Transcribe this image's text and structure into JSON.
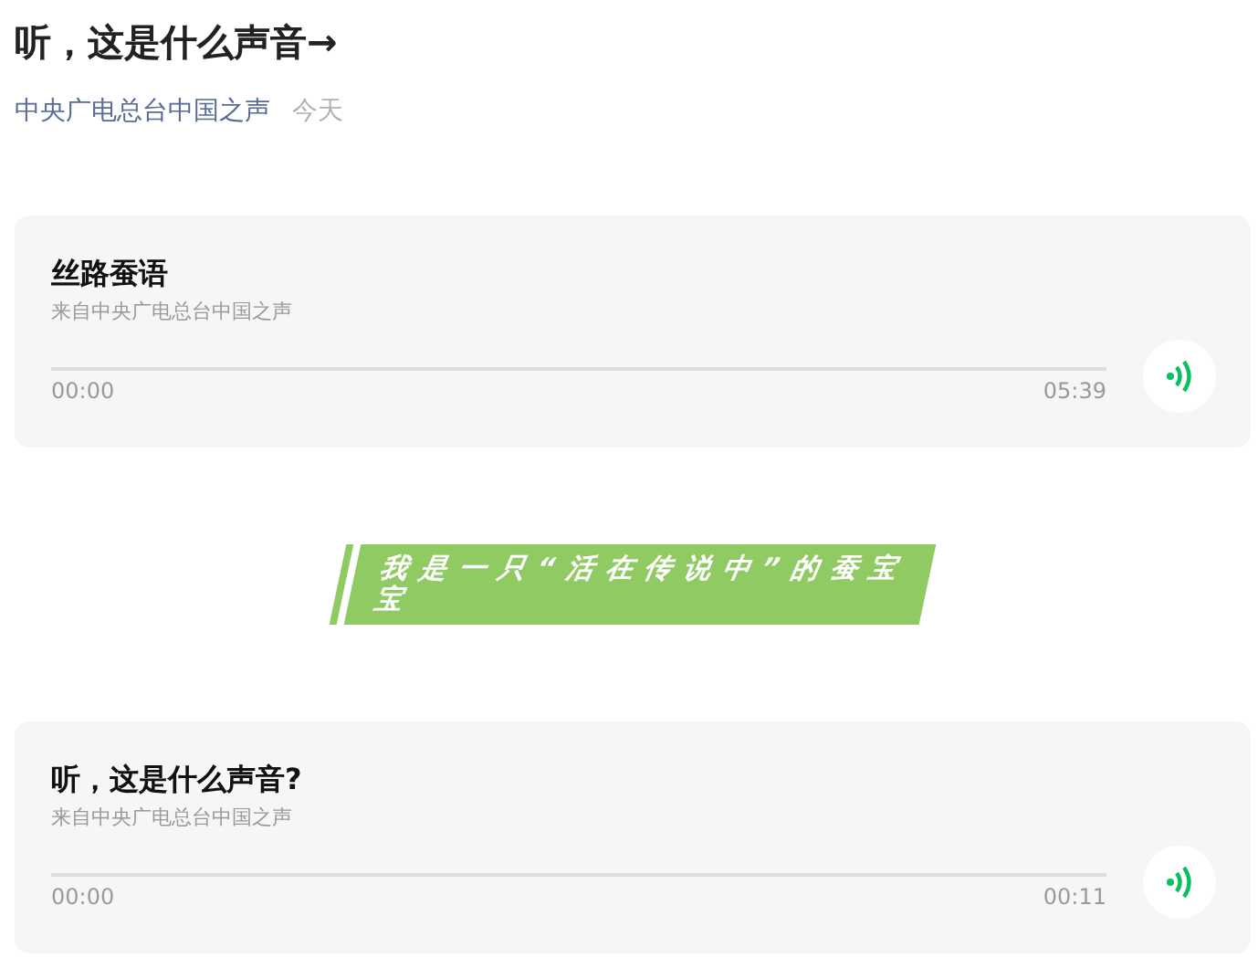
{
  "title": "听，这是什么声音→",
  "meta": {
    "author": "中央广电总台中国之声",
    "date": "今天"
  },
  "sections": [
    {
      "kind": "audio",
      "title": "丝路蚕语",
      "source": "来自中央广电总台中国之声",
      "elapsed": "00:00",
      "duration": "05:39",
      "level": 0
    },
    {
      "kind": "banner",
      "text": "我是一只“活在传说中”的蚕宝宝"
    },
    {
      "kind": "audio",
      "title": "听，这是什么声音?",
      "source": "来自中央广电总台中国之声",
      "elapsed": "00:00",
      "duration": "00:11",
      "level": 0
    }
  ]
}
